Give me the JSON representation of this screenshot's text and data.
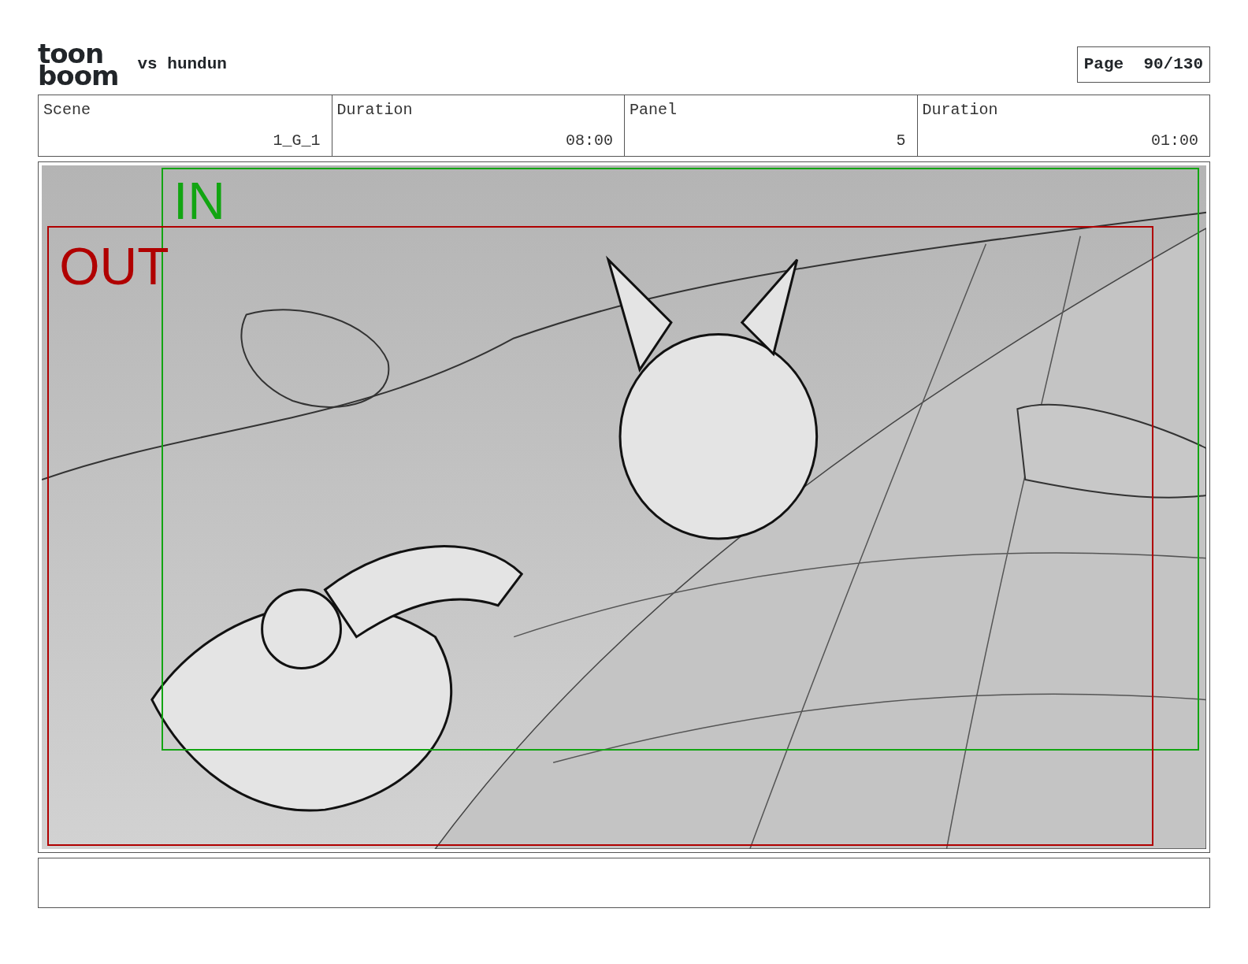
{
  "header": {
    "logo": [
      "toon",
      "boom"
    ],
    "title": "vs hundun",
    "page_label": "Page",
    "page_number": "90/130"
  },
  "info": [
    {
      "label": "Scene",
      "value": "1_G_1"
    },
    {
      "label": "Duration",
      "value": "08:00"
    },
    {
      "label": "Panel",
      "value": "5"
    },
    {
      "label": "Duration",
      "value": "01:00"
    }
  ],
  "panel": {
    "frames": [
      {
        "label": "IN",
        "color": "#12a512"
      },
      {
        "label": "OUT",
        "color": "#b00000"
      }
    ]
  }
}
